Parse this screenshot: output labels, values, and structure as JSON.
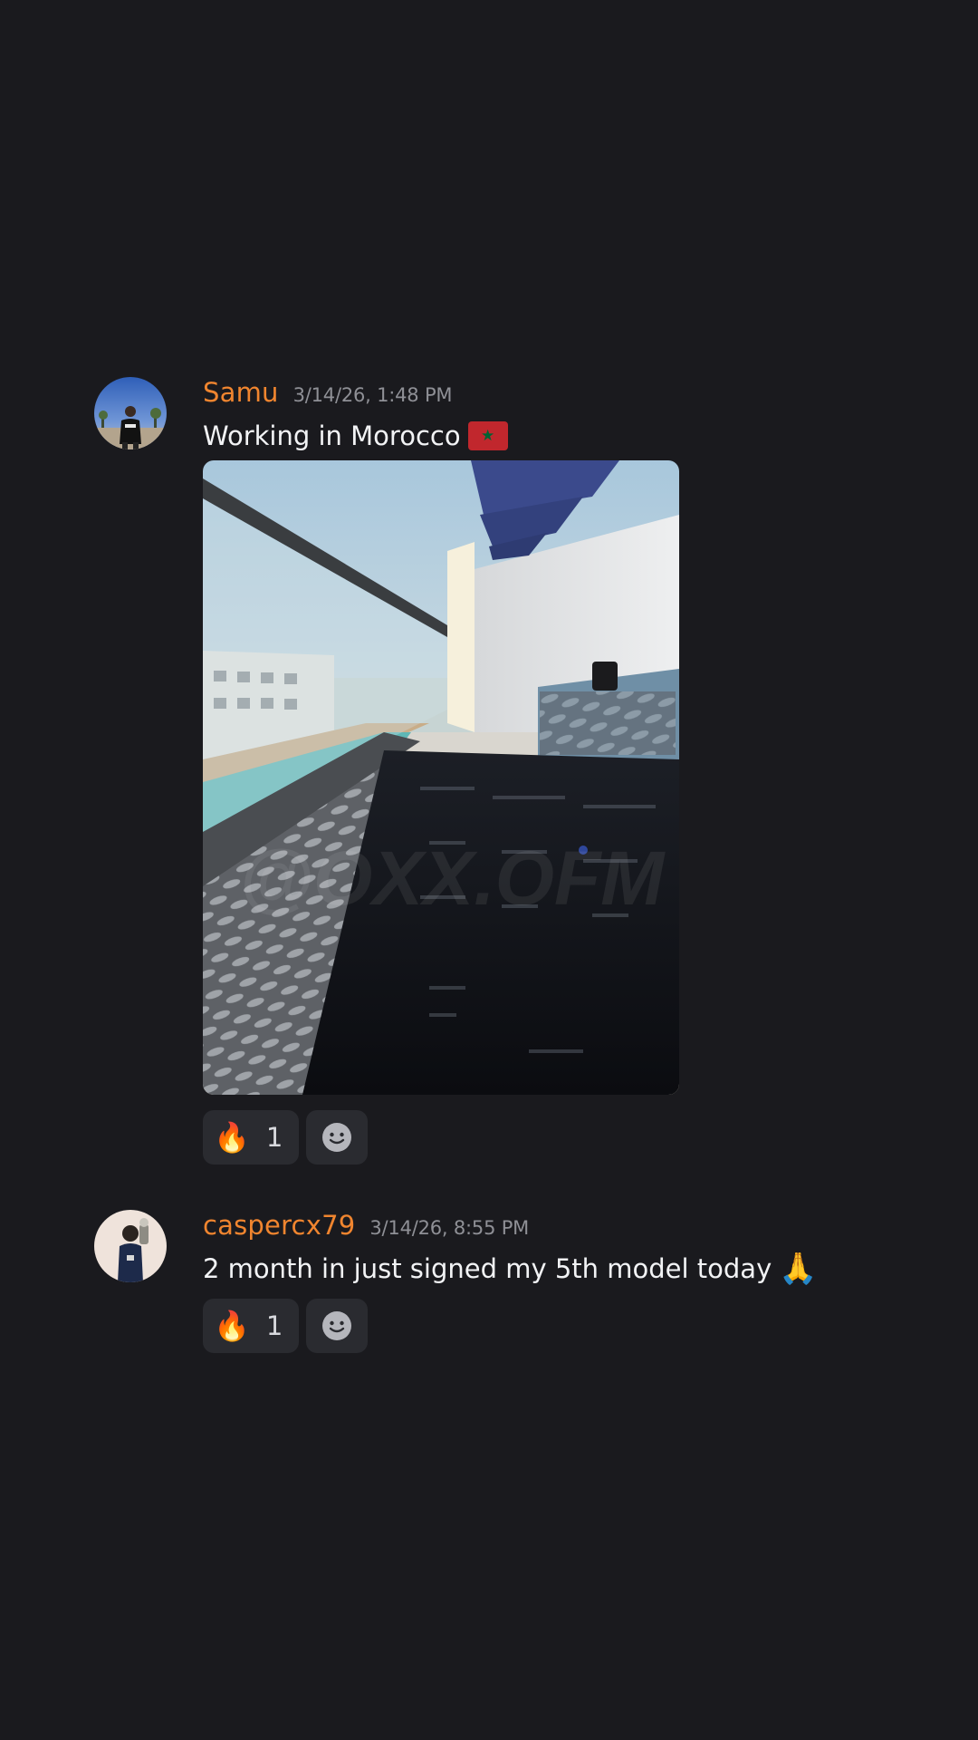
{
  "messages": [
    {
      "username": "Samu",
      "timestamp": "3/14/26, 1:48 PM",
      "text": "Working in Morocco",
      "flag_icon": "morocco-flag-icon",
      "attachment": {
        "description_icon": "balcony-laptop-photo",
        "watermark": "@OXX.OFM"
      },
      "reactions": [
        {
          "emoji": "🔥",
          "count": "1"
        }
      ],
      "add_reaction_icon": "smiley-face-icon"
    },
    {
      "username": "caspercx79",
      "timestamp": "3/14/26, 8:55 PM",
      "text": "2 month in just signed my 5th model today",
      "trailing_emoji": "🙏",
      "reactions": [
        {
          "emoji": "🔥",
          "count": "1"
        }
      ],
      "add_reaction_icon": "smiley-face-icon"
    }
  ],
  "colors": {
    "background": "#1a1a1e",
    "username": "#f0852f",
    "timestamp": "#8f9096",
    "reaction_bg": "#2a2b30"
  }
}
